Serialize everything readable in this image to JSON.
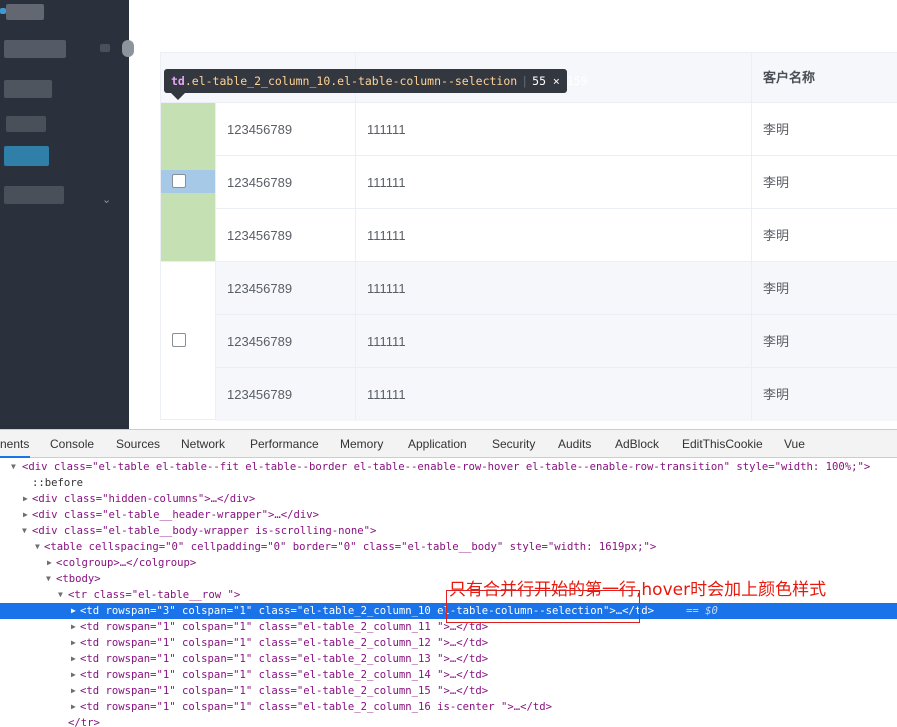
{
  "table": {
    "headers": {
      "customer": "客户名称"
    },
    "rows": [
      {
        "col1": "123456789",
        "col2": "111111",
        "customer": "李明"
      },
      {
        "col1": "123456789",
        "col2": "111111",
        "customer": "李明"
      },
      {
        "col1": "123456789",
        "col2": "111111",
        "customer": "李明"
      },
      {
        "col1": "123456789",
        "col2": "111111",
        "customer": "李明"
      },
      {
        "col1": "123456789",
        "col2": "111111",
        "customer": "李明"
      },
      {
        "col1": "123456789",
        "col2": "111111",
        "customer": "李明"
      }
    ]
  },
  "tooltip": {
    "tag": "td",
    "classes": ".el-table_2_column_10.el-table-column--selection",
    "size": "55 × 159"
  },
  "devtools": {
    "tabs": [
      "nents",
      "Console",
      "Sources",
      "Network",
      "Performance",
      "Memory",
      "Application",
      "Security",
      "Audits",
      "AdBlock",
      "EditThisCookie",
      "Vue"
    ],
    "lines": [
      "<div class=\"el-table el-table--fit el-table--border el-table--enable-row-hover el-table--enable-row-transition\" style=\"width: 100%;\">",
      "::before",
      "<div class=\"hidden-columns\">…</div>",
      "<div class=\"el-table__header-wrapper\">…</div>",
      "<div class=\"el-table__body-wrapper is-scrolling-none\">",
      "<table cellspacing=\"0\" cellpadding=\"0\" border=\"0\" class=\"el-table__body\" style=\"width: 1619px;\">",
      "<colgroup>…</colgroup>",
      "<tbody>",
      "<tr class=\"el-table__row \">",
      "<td rowspan=\"3\" colspan=\"1\" class=\"el-table_2_column_10  el-table-column--selection\">…</td>",
      "<td rowspan=\"1\" colspan=\"1\" class=\"el-table_2_column_11  \">…</td>",
      "<td rowspan=\"1\" colspan=\"1\" class=\"el-table_2_column_12  \">…</td>",
      "<td rowspan=\"1\" colspan=\"1\" class=\"el-table_2_column_13  \">…</td>",
      "<td rowspan=\"1\" colspan=\"1\" class=\"el-table_2_column_14  \">…</td>",
      "<td rowspan=\"1\" colspan=\"1\" class=\"el-table_2_column_15  \">…</td>",
      "<td rowspan=\"1\" colspan=\"1\" class=\"el-table_2_column_16 is-center \">…</td>",
      "</tr>"
    ],
    "selected_suffix": "== $0"
  },
  "annotation": {
    "text": "只有合并行开始的第一行,hover时会加上颜色样式"
  },
  "colors": {
    "sidebar": "#2a313d",
    "selection_green": "#c5e1b3",
    "selection_blue": "#a7c9e8",
    "devtools_selected": "#1a73e8",
    "annotation_red": "#e8180c"
  }
}
